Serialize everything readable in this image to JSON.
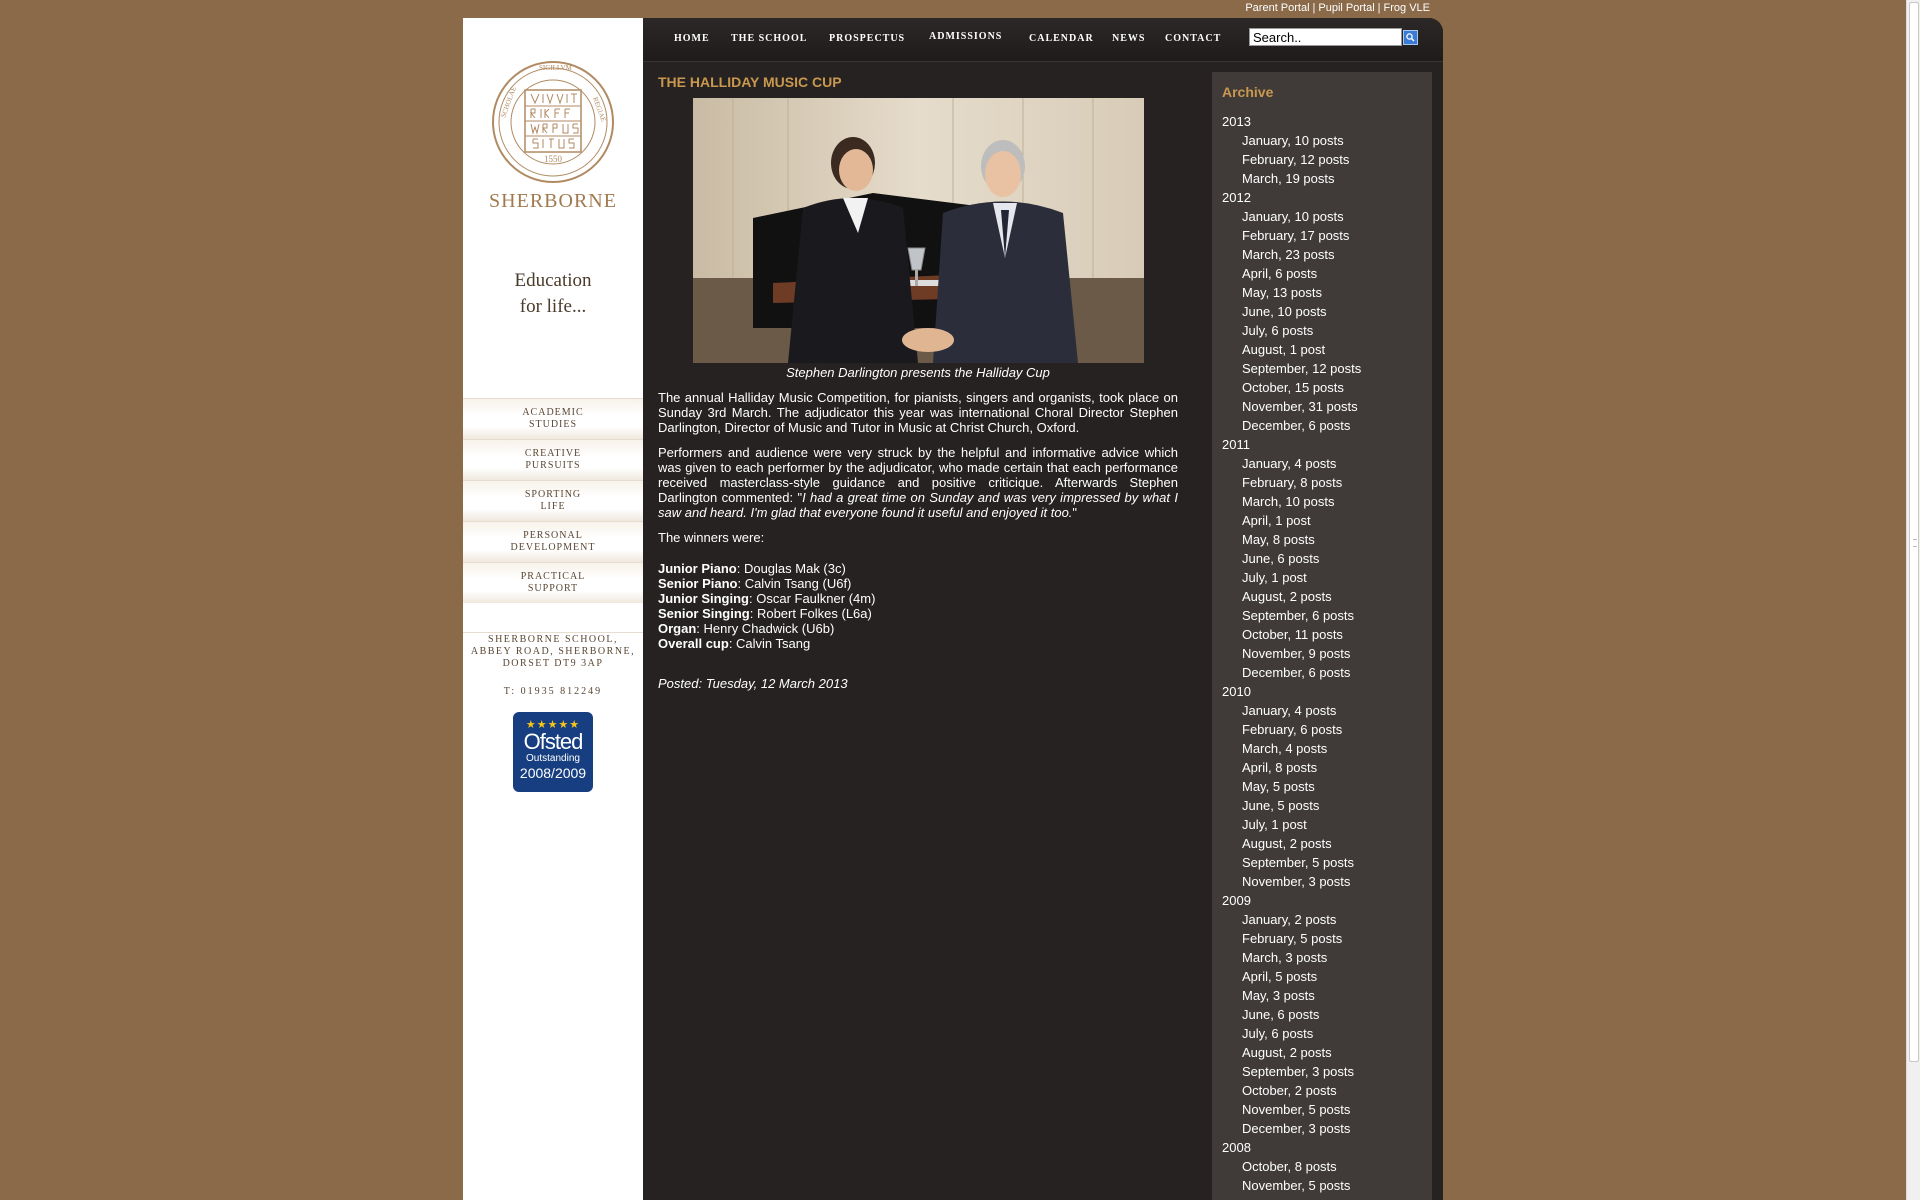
{
  "portal_links": [
    "Parent Portal",
    "Pupil Portal",
    "Frog VLE"
  ],
  "portal_separator": "|",
  "brand": {
    "seal_text": "1550",
    "name": "SHERBORNE",
    "tagline_line1": "Education",
    "tagline_line2": "for life..."
  },
  "side_menu": [
    {
      "line1": "ACADEMIC",
      "line2": "STUDIES"
    },
    {
      "line1": "CREATIVE",
      "line2": "PURSUITS"
    },
    {
      "line1": "SPORTING",
      "line2": "LIFE"
    },
    {
      "line1": "PERSONAL",
      "line2": "DEVELOPMENT"
    },
    {
      "line1": "PRACTICAL",
      "line2": "SUPPORT"
    }
  ],
  "address": {
    "line1": "SHERBORNE SCHOOL,",
    "line2": "ABBEY ROAD, SHERBORNE,",
    "line3": "DORSET DT9 3AP",
    "phone": "T: 01935 812249"
  },
  "ofsted": {
    "stars": "★★★★★",
    "name": "Ofsted",
    "grade": "Outstanding",
    "years": "2008/2009"
  },
  "nav": [
    "HOME",
    "THE SCHOOL",
    "PROSPECTUS",
    "ADMISSIONS",
    "CALENDAR",
    "NEWS",
    "CONTACT"
  ],
  "search": {
    "value": "Search.."
  },
  "article": {
    "title": "THE HALLIDAY MUSIC CUP",
    "caption": "Stephen Darlington presents the Halliday Cup",
    "para1": "The annual Halliday Music Competition, for pianists, singers and organists, took place on Sunday 3rd March. The adjudicator this year was international Choral Director Stephen Darlington, Director of Music and Tutor in Music at Christ Church, Oxford.",
    "para2_start": "Performers and audience were very struck by the helpful and informative advice which was given to each performer by the adjudicator, who made certain that each performance received masterclass-style guidance and positive criticique. Afterwards Stephen Darlington commented: \"",
    "para2_quote": "I had a great time on Sunday and was very impressed by what I saw and heard. I'm glad that everyone found it useful and enjoyed it too.",
    "para2_end": "\"",
    "winners_intro": "The winners were:",
    "winners": [
      {
        "category": "Junior Piano",
        "name": ": Douglas Mak (3c)"
      },
      {
        "category": "Senior Piano",
        "name": ": Calvin Tsang (U6f)"
      },
      {
        "category": "Junior Singing",
        "name": ": Oscar Faulkner (4m)"
      },
      {
        "category": "Senior Singing",
        "name": ": Robert Folkes (L6a)"
      },
      {
        "category": "Organ",
        "name": ": Henry Chadwick (U6b)"
      },
      {
        "category": "Overall cup",
        "name": ": Calvin Tsang"
      }
    ],
    "posted": "Posted: Tuesday, 12 March 2013"
  },
  "archive": {
    "title": "Archive",
    "years": [
      {
        "year": "2013",
        "months": [
          "January, 10 posts",
          "February, 12 posts",
          "March, 19 posts"
        ]
      },
      {
        "year": "2012",
        "months": [
          "January, 10 posts",
          "February, 17 posts",
          "March, 23 posts",
          "April, 6 posts",
          "May, 13 posts",
          "June, 10 posts",
          "July, 6 posts",
          "August, 1 post",
          "September, 12 posts",
          "October, 15 posts",
          "November, 31 posts",
          "December, 6 posts"
        ]
      },
      {
        "year": "2011",
        "months": [
          "January, 4 posts",
          "February, 8 posts",
          "March, 10 posts",
          "April, 1 post",
          "May, 8 posts",
          "June, 6 posts",
          "July, 1 post",
          "August, 2 posts",
          "September, 6 posts",
          "October, 11 posts",
          "November, 9 posts",
          "December, 6 posts"
        ]
      },
      {
        "year": "2010",
        "months": [
          "January, 4 posts",
          "February, 6 posts",
          "March, 4 posts",
          "April, 8 posts",
          "May, 5 posts",
          "June, 5 posts",
          "July, 1 post",
          "August, 2 posts",
          "September, 5 posts",
          "November, 3 posts"
        ]
      },
      {
        "year": "2009",
        "months": [
          "January, 2 posts",
          "February, 5 posts",
          "March, 3 posts",
          "April, 5 posts",
          "May, 3 posts",
          "June, 6 posts",
          "July, 6 posts",
          "August, 2 posts",
          "September, 3 posts",
          "October, 2 posts",
          "November, 5 posts",
          "December, 3 posts"
        ]
      },
      {
        "year": "2008",
        "months": [
          "October, 8 posts",
          "November, 5 posts"
        ]
      }
    ]
  },
  "colors": {
    "page_bg": "#8a6a48",
    "main_bg": "#262221",
    "archive_bg": "#403b39",
    "accent": "#c9984e"
  }
}
